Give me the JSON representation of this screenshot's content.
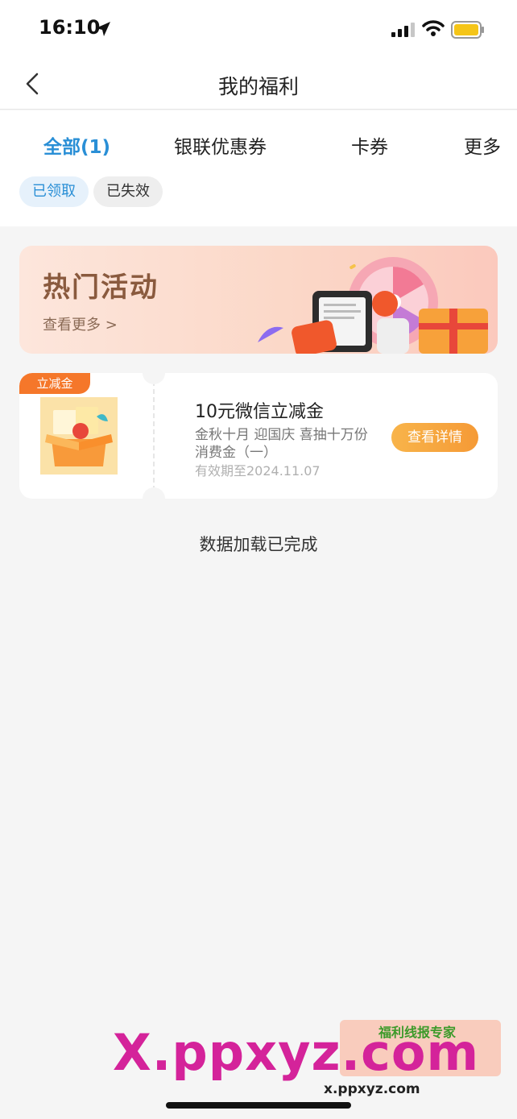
{
  "status_bar": {
    "time": "16:10"
  },
  "nav": {
    "title": "我的福利"
  },
  "tabs": [
    {
      "label": "全部(1)",
      "active": true
    },
    {
      "label": "银联优惠券",
      "active": false
    },
    {
      "label": "卡券",
      "active": false
    },
    {
      "label": "更多",
      "active": false
    }
  ],
  "filters": [
    {
      "label": "已领取",
      "active": true
    },
    {
      "label": "已失效",
      "active": false
    }
  ],
  "hot_banner": {
    "title": "热门活动",
    "more_label": "查看更多 >"
  },
  "coupon": {
    "tag": "立减金",
    "title": "10元微信立减金",
    "description": "金秋十月 迎国庆 喜抽十万份消费金（一）",
    "expiry": "有效期至2024.11.07",
    "button_label": "查看详情"
  },
  "footer_text": "数据加载已完成",
  "watermark": {
    "text": "X.ppxyz.com",
    "badge_title": "福利线报专家",
    "url": "x.ppxyz.com"
  },
  "colors": {
    "accent": "#2a8fd6",
    "tag_orange": "#f5772a",
    "button_orange": "#f5a23c"
  }
}
